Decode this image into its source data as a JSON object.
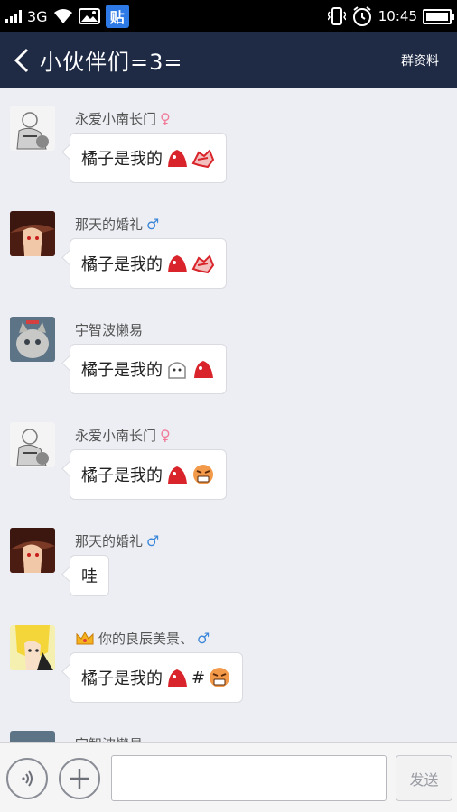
{
  "status_bar": {
    "network": "3G",
    "time": "10:45",
    "icons": [
      "signal-icon",
      "wifi-icon",
      "image-icon",
      "tieba-icon",
      "vibrate-icon",
      "alarm-icon",
      "battery-icon"
    ],
    "tieba_glyph": "贴"
  },
  "header": {
    "title": "小伙伴们=3=",
    "group_info": "群资料",
    "back_icon": "chevron-left-icon"
  },
  "messages": [
    {
      "sender": "永爱小南长门",
      "gender": "♀",
      "text": "橘子是我的",
      "emojis": [
        "red-blob-emoji",
        "red-smash-emoji"
      ],
      "hash": ""
    },
    {
      "sender": "那天的婚礼",
      "gender": "♂",
      "text": "橘子是我的",
      "emojis": [
        "red-blob-emoji",
        "red-smash-emoji"
      ],
      "hash": ""
    },
    {
      "sender": "宇智波懒易",
      "gender": "",
      "text": "橘子是我的",
      "emojis": [
        "white-ghost-emoji",
        "red-blob-emoji"
      ],
      "hash": ""
    },
    {
      "sender": "永爱小南长门",
      "gender": "♀",
      "text": "橘子是我的",
      "emojis": [
        "red-blob-emoji",
        "angry-face-emoji"
      ],
      "hash": ""
    },
    {
      "sender": "那天的婚礼",
      "gender": "♂",
      "text": "哇",
      "emojis": [],
      "hash": ""
    },
    {
      "sender": "你的良辰美景、",
      "gender": "♂",
      "crown": true,
      "text": "橘子是我的",
      "emojis": [
        "red-blob-emoji",
        "angry-face-emoji"
      ],
      "hash": "#"
    },
    {
      "sender": "宇智波懒易",
      "gender": "",
      "text": "",
      "emojis": [],
      "hash": ""
    }
  ],
  "input": {
    "placeholder": "",
    "send_label": "发送"
  },
  "colors": {
    "title_bar": "#1f2a45",
    "chat_bg": "#eceef3",
    "female": "#f07c9a",
    "male": "#3b86d8",
    "tieba_blue": "#2d7ae6"
  }
}
